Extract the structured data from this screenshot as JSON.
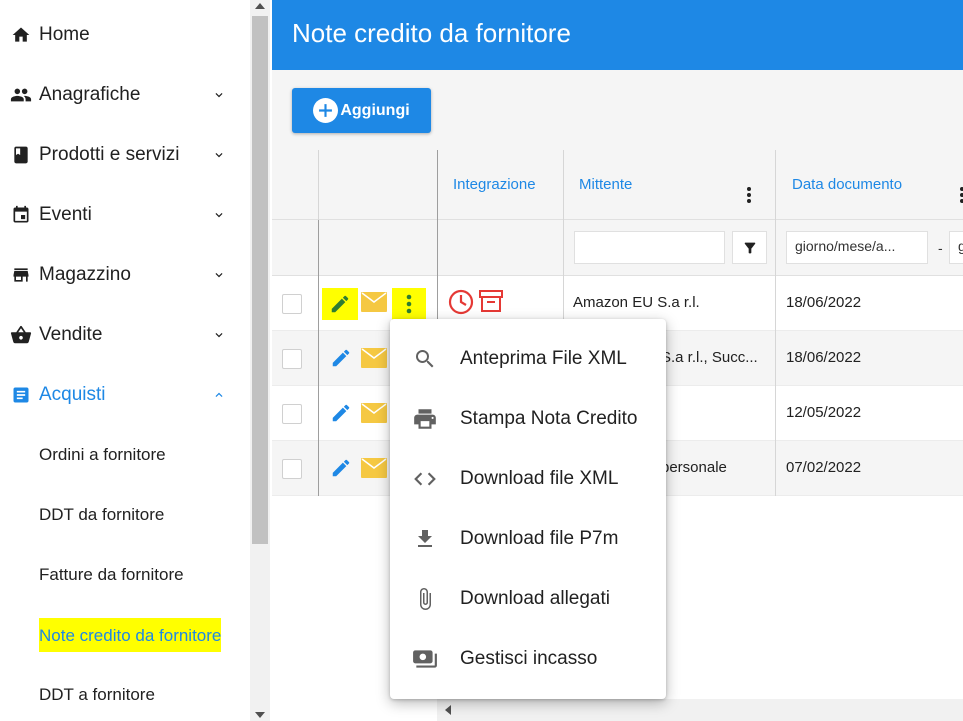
{
  "sidebar": {
    "items": [
      {
        "label": "Home",
        "icon": "home-icon",
        "expandable": false
      },
      {
        "label": "Anagrafiche",
        "icon": "people-icon",
        "expandable": true
      },
      {
        "label": "Prodotti e servizi",
        "icon": "book-icon",
        "expandable": true
      },
      {
        "label": "Eventi",
        "icon": "calendar-icon",
        "expandable": true
      },
      {
        "label": "Magazzino",
        "icon": "warehouse-icon",
        "expandable": true
      },
      {
        "label": "Vendite",
        "icon": "basket-icon",
        "expandable": true
      },
      {
        "label": "Acquisti",
        "icon": "receipt-icon",
        "expandable": true,
        "expanded": true
      }
    ],
    "subitems": [
      {
        "label": "Ordini a fornitore"
      },
      {
        "label": "DDT da fornitore"
      },
      {
        "label": "Fatture da fornitore"
      },
      {
        "label": "Note credito da fornitore",
        "selected": true
      },
      {
        "label": "DDT a fornitore"
      }
    ]
  },
  "header": {
    "title": "Note credito da fornitore"
  },
  "toolbar": {
    "add_label": "Aggiungi"
  },
  "grid": {
    "columns": [
      {
        "label": "Integrazione"
      },
      {
        "label": "Mittente"
      },
      {
        "label": "Data documento"
      }
    ],
    "filters": {
      "date_placeholder": "giorno/mese/a...",
      "date_separator": "-",
      "date_to_partial": "g"
    },
    "rows": [
      {
        "mittente": "Amazon EU S.a r.l.",
        "data": "18/06/2022"
      },
      {
        "mittente": "S.a r.l., Succ...",
        "data": "18/06/2022"
      },
      {
        "mittente": "",
        "data": "12/05/2022"
      },
      {
        "mittente": "personale",
        "data": "07/02/2022"
      }
    ]
  },
  "menu": {
    "items": [
      {
        "label": "Anteprima File XML",
        "icon": "search-icon"
      },
      {
        "label": "Stampa Nota Credito",
        "icon": "print-icon"
      },
      {
        "label": "Download file XML",
        "icon": "code-icon"
      },
      {
        "label": "Download file P7m",
        "icon": "download-icon"
      },
      {
        "label": "Download allegati",
        "icon": "attachment-icon"
      },
      {
        "label": "Gestisci incasso",
        "icon": "payments-icon"
      }
    ]
  },
  "colors": {
    "primary": "#1e88e5",
    "highlight": "#ffff00",
    "mail": "#f5c842",
    "danger": "#e53935"
  }
}
